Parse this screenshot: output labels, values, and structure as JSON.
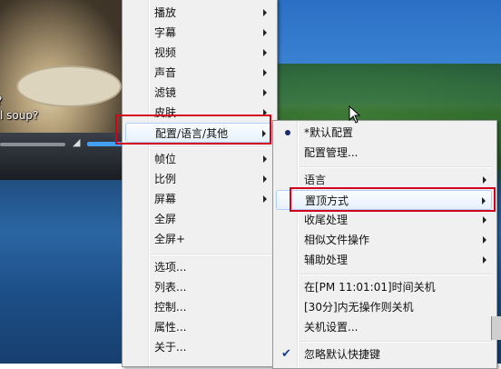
{
  "background": {
    "subtitle_line1": "?",
    "subtitle_line2": "l soup?"
  },
  "main_menu": {
    "items": [
      {
        "label": "播放",
        "submenu": true
      },
      {
        "label": "字幕",
        "submenu": true
      },
      {
        "label": "视频",
        "submenu": true
      },
      {
        "label": "声音",
        "submenu": true
      },
      {
        "label": "滤镜",
        "submenu": true
      },
      {
        "label": "皮肤",
        "submenu": true
      },
      {
        "label": "配置/语言/其他",
        "submenu": true,
        "highlighted": true
      },
      {
        "label": "帧位",
        "submenu": true
      },
      {
        "label": "比例",
        "submenu": true
      },
      {
        "label": "屏幕",
        "submenu": true
      },
      {
        "label": "全屏",
        "submenu": false
      },
      {
        "label": "全屏+",
        "submenu": false
      },
      {
        "label": "选项...",
        "submenu": false
      },
      {
        "label": "列表...",
        "submenu": false
      },
      {
        "label": "控制...",
        "submenu": false
      },
      {
        "label": "属性...",
        "submenu": false
      },
      {
        "label": "关于...",
        "submenu": false
      }
    ]
  },
  "sub_menu": {
    "items": [
      {
        "label": "*默认配置",
        "mark": "bullet"
      },
      {
        "label": "配置管理...",
        "mark": "none"
      },
      {
        "label": "语言",
        "submenu": true
      },
      {
        "label": "置顶方式",
        "submenu": true,
        "highlighted": true
      },
      {
        "label": "收尾处理",
        "submenu": true
      },
      {
        "label": "相似文件操作",
        "submenu": true
      },
      {
        "label": "辅助处理",
        "submenu": true
      },
      {
        "label": "在[PM 11:01:01]时间关机",
        "mark": "none"
      },
      {
        "label": "[30分]内无操作则关机",
        "mark": "none"
      },
      {
        "label": "关机设置...",
        "mark": "none"
      },
      {
        "label": "忽略默认快捷键",
        "mark": "check"
      }
    ]
  },
  "colors": {
    "annotation_red": "#d4001c",
    "menu_background": "#f0f0f0"
  },
  "icons": {
    "volume": "speaker-icon",
    "bullet": "radio-bullet-icon",
    "check": "checkmark-icon",
    "cursor": "mouse-pointer-icon"
  }
}
